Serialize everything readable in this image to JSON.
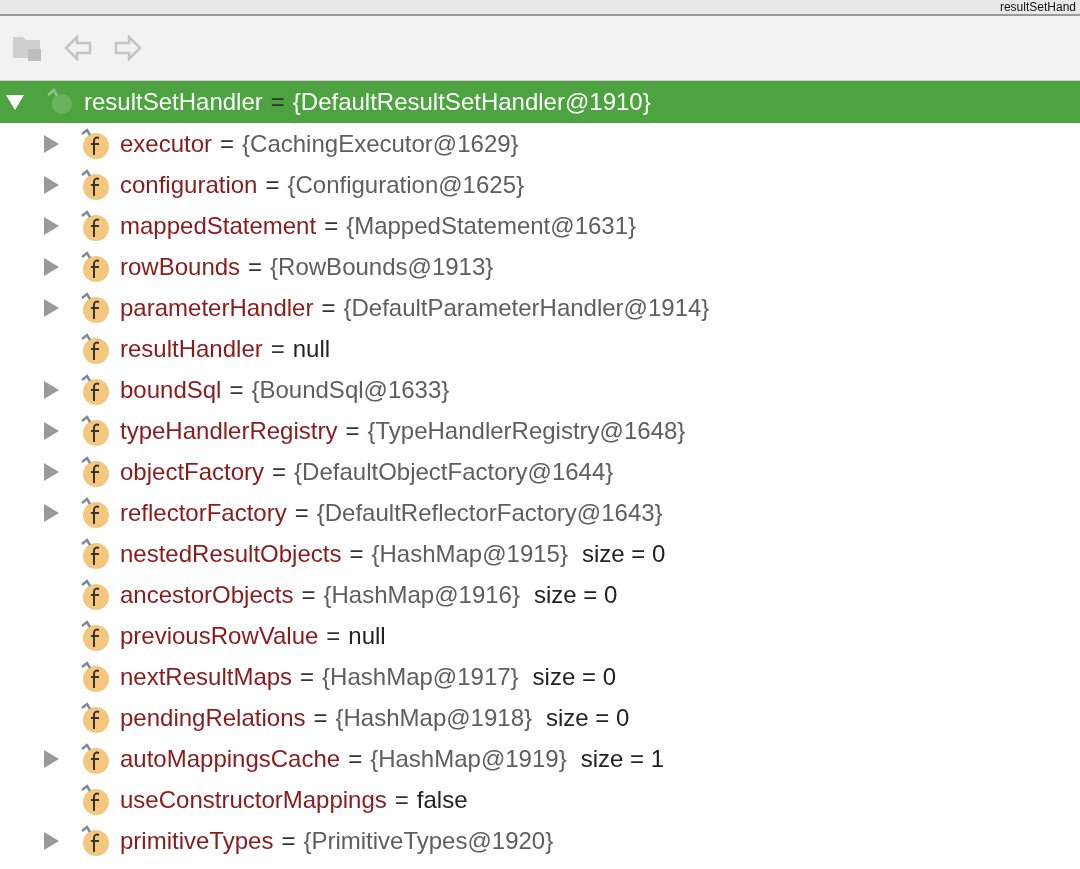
{
  "window": {
    "title": "resultSetHand"
  },
  "root": {
    "name": "resultSetHandler",
    "eq": "=",
    "value": "{DefaultResultSetHandler@1910}",
    "expanded": true,
    "selected": true,
    "children": [
      {
        "name": "executor",
        "value": "{CachingExecutor@1629}",
        "kind": "object",
        "expandable": true
      },
      {
        "name": "configuration",
        "value": "{Configuration@1625}",
        "kind": "object",
        "expandable": true
      },
      {
        "name": "mappedStatement",
        "value": "{MappedStatement@1631}",
        "kind": "object",
        "expandable": true
      },
      {
        "name": "rowBounds",
        "value": "{RowBounds@1913}",
        "kind": "object",
        "expandable": true
      },
      {
        "name": "parameterHandler",
        "value": "{DefaultParameterHandler@1914}",
        "kind": "object",
        "expandable": true
      },
      {
        "name": "resultHandler",
        "value": "null",
        "kind": "literal",
        "expandable": false
      },
      {
        "name": "boundSql",
        "value": "{BoundSql@1633}",
        "kind": "object",
        "expandable": true
      },
      {
        "name": "typeHandlerRegistry",
        "value": "{TypeHandlerRegistry@1648}",
        "kind": "object",
        "expandable": true
      },
      {
        "name": "objectFactory",
        "value": "{DefaultObjectFactory@1644}",
        "kind": "object",
        "expandable": true
      },
      {
        "name": "reflectorFactory",
        "value": "{DefaultReflectorFactory@1643}",
        "kind": "object",
        "expandable": true
      },
      {
        "name": "nestedResultObjects",
        "value": "{HashMap@1915}",
        "size": "size = 0",
        "kind": "object",
        "expandable": false
      },
      {
        "name": "ancestorObjects",
        "value": "{HashMap@1916}",
        "size": "size = 0",
        "kind": "object",
        "expandable": false
      },
      {
        "name": "previousRowValue",
        "value": "null",
        "kind": "literal",
        "expandable": false
      },
      {
        "name": "nextResultMaps",
        "value": "{HashMap@1917}",
        "size": "size = 0",
        "kind": "object",
        "expandable": false
      },
      {
        "name": "pendingRelations",
        "value": "{HashMap@1918}",
        "size": "size = 0",
        "kind": "object",
        "expandable": false
      },
      {
        "name": "autoMappingsCache",
        "value": "{HashMap@1919}",
        "size": "size = 1",
        "kind": "object",
        "expandable": true
      },
      {
        "name": "useConstructorMappings",
        "value": "false",
        "kind": "literal",
        "expandable": false
      },
      {
        "name": "primitiveTypes",
        "value": "{PrimitiveTypes@1920}",
        "kind": "object",
        "expandable": true
      }
    ]
  }
}
